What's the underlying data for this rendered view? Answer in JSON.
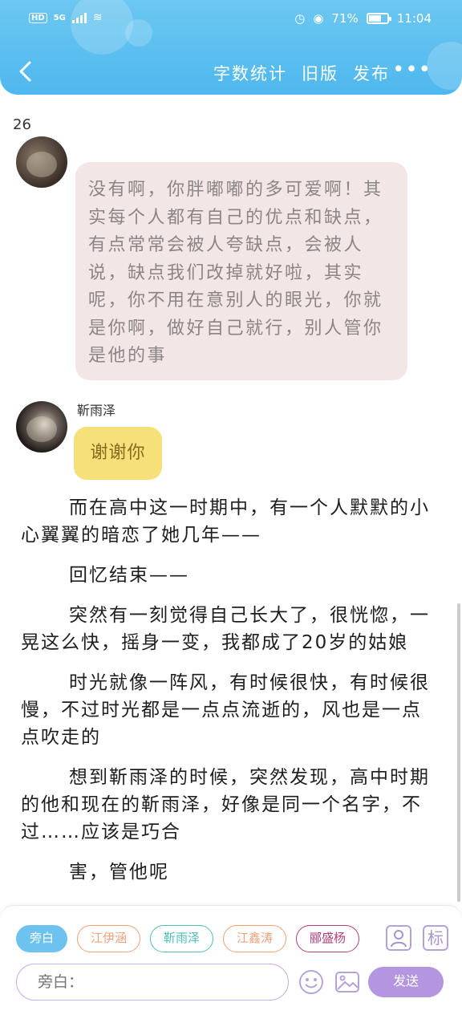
{
  "status_bar": {
    "hd": "HD",
    "network": "5G",
    "battery_percent": "71%",
    "battery_level": 0.71,
    "time": "11:04"
  },
  "toolbar": {
    "word_count": "字数统计",
    "old_version": "旧版",
    "publish": "发布",
    "more": "•••"
  },
  "counter": "26",
  "chat": {
    "message1": "没有啊，你胖嘟嘟的多可爱啊！其实每个人都有自己的优点和缺点，有点常常会被人夸缺点，会被人说，缺点我们改掉就好啦，其实呢，你不用在意别人的眼光，你就是你啊，做好自己就行，别人管你是他的事",
    "sender2_name": "靳雨泽",
    "message2": "谢谢你"
  },
  "story": [
    "而在高中这一时期中，有一个人默默的小心翼翼的暗恋了她几年——",
    "回忆结束——",
    "突然有一刻觉得自己长大了，很恍惚，一晃这么快，摇身一变，我都成了20岁的姑娘",
    "时光就像一阵风，有时候很快，有时候很慢，不过时光都是一点点流逝的，风也是一点点吹走的",
    "想到靳雨泽的时候，突然发现，高中时期的他和现在的靳雨泽，好像是同一个名字，不过……应该是巧合",
    "害，管他呢"
  ],
  "characters": [
    {
      "label": "旁白",
      "color": "#6ec2ef"
    },
    {
      "label": "江伊涵",
      "color": "#f0a27a"
    },
    {
      "label": "靳雨泽",
      "color": "#4fbfb9"
    },
    {
      "label": "江鑫涛",
      "color": "#f0a27a"
    },
    {
      "label": "郦盛杨",
      "color": "#b0407a"
    }
  ],
  "panel": {
    "mark_icon_label": "标",
    "input_placeholder": "旁白：",
    "send_label": "发送"
  },
  "colors": {
    "header": "#5bbcef",
    "send_button": "#b395e0",
    "accent_purple": "#c7b0e3"
  }
}
